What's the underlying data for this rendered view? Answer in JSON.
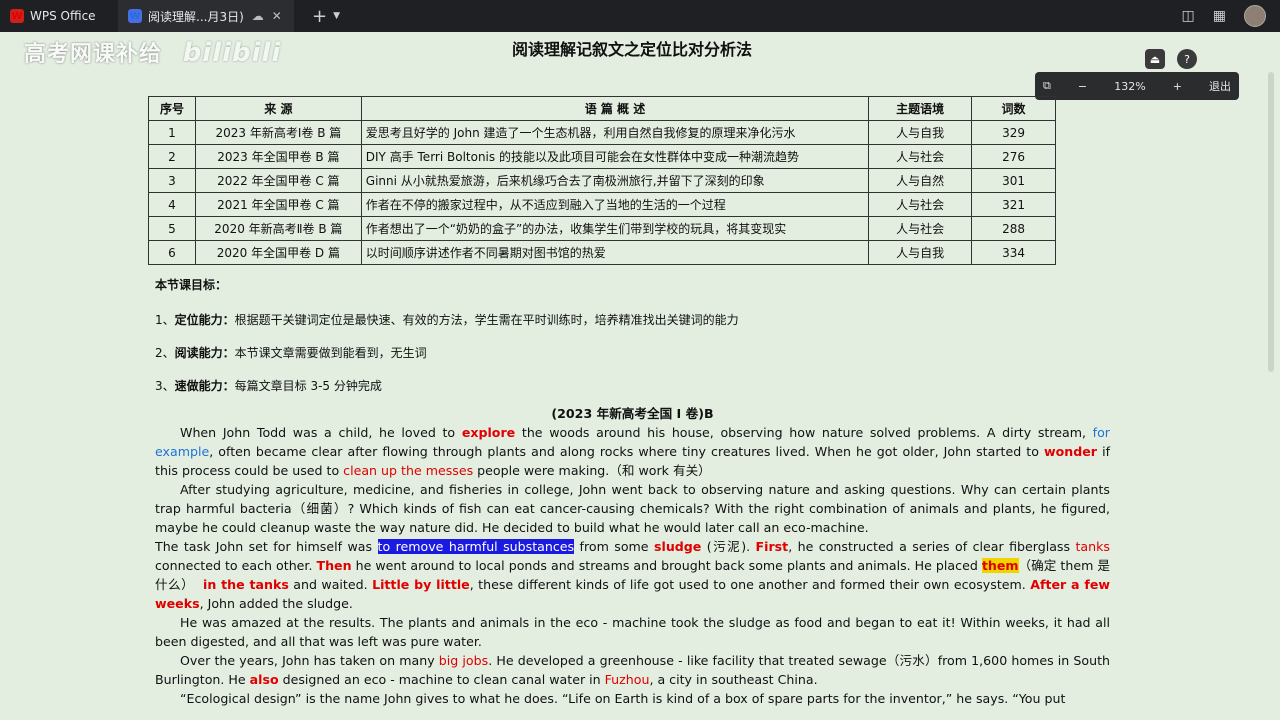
{
  "titlebar": {
    "app_tab": "WPS Office",
    "doc_tab": "阅读理解...月3日)",
    "close_glyph": "✕",
    "new_tab_glyph": "+"
  },
  "watermark": {
    "text": "高考网课补给",
    "logo": "bilibili"
  },
  "doc": {
    "title": "阅读理解记叙文之定位比对分析法"
  },
  "zoom": {
    "fit": "⧉",
    "minus": "−",
    "value": "132%",
    "plus": "+",
    "exit": "退出"
  },
  "table": {
    "headers": [
      "序号",
      "来 源",
      "语 篇 概 述",
      "主题语境",
      "词数"
    ],
    "rows": [
      [
        "1",
        "2023 年新高考Ⅰ卷 B 篇",
        "爱思考且好学的 John 建造了一个生态机器，利用自然自我修复的原理来净化污水",
        "人与自我",
        "329"
      ],
      [
        "2",
        "2023 年全国甲卷 B 篇",
        "DIY 高手 Terri Boltonis 的技能以及此项目可能会在女性群体中变成一种潮流趋势",
        "人与社会",
        "276"
      ],
      [
        "3",
        "2022 年全国甲卷 C 篇",
        "Ginni 从小就热爱旅游，后来机缘巧合去了南极洲旅行,并留下了深刻的印象",
        "人与自然",
        "301"
      ],
      [
        "4",
        "2021 年全国甲卷 C 篇",
        "作者在不停的搬家过程中，从不适应到融入了当地的生活的一个过程",
        "人与社会",
        "321"
      ],
      [
        "5",
        "2020 年新高考Ⅱ卷 B 篇",
        "作者想出了一个“奶奶的盒子”的办法，收集学生们带到学校的玩具，将其变现实",
        "人与社会",
        "288"
      ],
      [
        "6",
        "2020 年全国甲卷 D 篇",
        "以时间顺序讲述作者不同暑期对图书馆的热爱",
        "人与自我",
        "334"
      ]
    ]
  },
  "goals": {
    "heading": "本节课目标：",
    "items": [
      {
        "num": "1、",
        "label": "定位能力：",
        "text": "根据题干关键词定位是最快速、有效的方法，学生需在平时训练时，培养精准找出关键词的能力"
      },
      {
        "num": "2、",
        "label": "阅读能力：",
        "text": "本节课文章需要做到能看到，无生词"
      },
      {
        "num": "3、",
        "label": "速做能力：",
        "text": "每篇文章目标 3-5 分钟完成"
      }
    ]
  },
  "passage": {
    "title": "(2023 年新高考全国 Ⅰ 卷)B",
    "p1": {
      "a": "When John Todd was a child, he loved to ",
      "b": "explore",
      "c": " the woods around his house, observing how nature solved problems. A dirty stream, ",
      "d": "for example",
      "e": ", often became clear after flowing through plants and along rocks where tiny creatures lived. When he got older, John started to ",
      "f": "wonder",
      "g": " if this process could be used to ",
      "h": "clean up the messes",
      "i": " people were making.（和 work 有关）"
    },
    "p2": "After studying agriculture, medicine, and fisheries in college, John went back to observing nature and asking questions. Why can certain plants trap harmful bacteria（细菌）? Which kinds of fish can eat cancer-causing chemicals? With the right combination of animals and plants, he figured, maybe he could cleanup waste the way nature did. He decided to build what he would later call an eco-machine.",
    "p3": {
      "a": "The task John set for himself was ",
      "b": "to remove harmful substances",
      "c": " from some ",
      "d": "sludge",
      "e": " (污泥). ",
      "f": "First",
      "g": ", he constructed a series of clear fiberglass ",
      "h": "tanks",
      "i": " connected to each other. ",
      "j": "Then",
      "k": " he went around to local ponds and streams and brought back some plants and animals. He placed ",
      "l": "them",
      "m": "（确定 them 是什么）",
      "n": "in the tanks",
      "o": " and waited. ",
      "p": "Little by little",
      "q": ", these different kinds of life got used to one another and formed their own ecosystem. ",
      "r": "After a few weeks",
      "s": ", John added the sludge."
    },
    "p4": "He was amazed at the results. The plants and animals in the eco - machine took the sludge as food and began to eat it! Within weeks, it had all been digested, and all that was left was pure water.",
    "p5": {
      "a": "Over the years, John has taken on many ",
      "b": "big jobs",
      "c": ". He developed a greenhouse - like facility that treated sewage（污水）from 1,600 homes in South Burlington. He ",
      "d": "also",
      "e": " designed an eco - machine to clean canal water in ",
      "f": "Fuzhou",
      "g": ", a city in southeast China."
    },
    "p6": "“Ecological design” is the name John gives to what he does. “Life on Earth is kind of a box of spare parts for the inventor,” he says. “You put"
  }
}
